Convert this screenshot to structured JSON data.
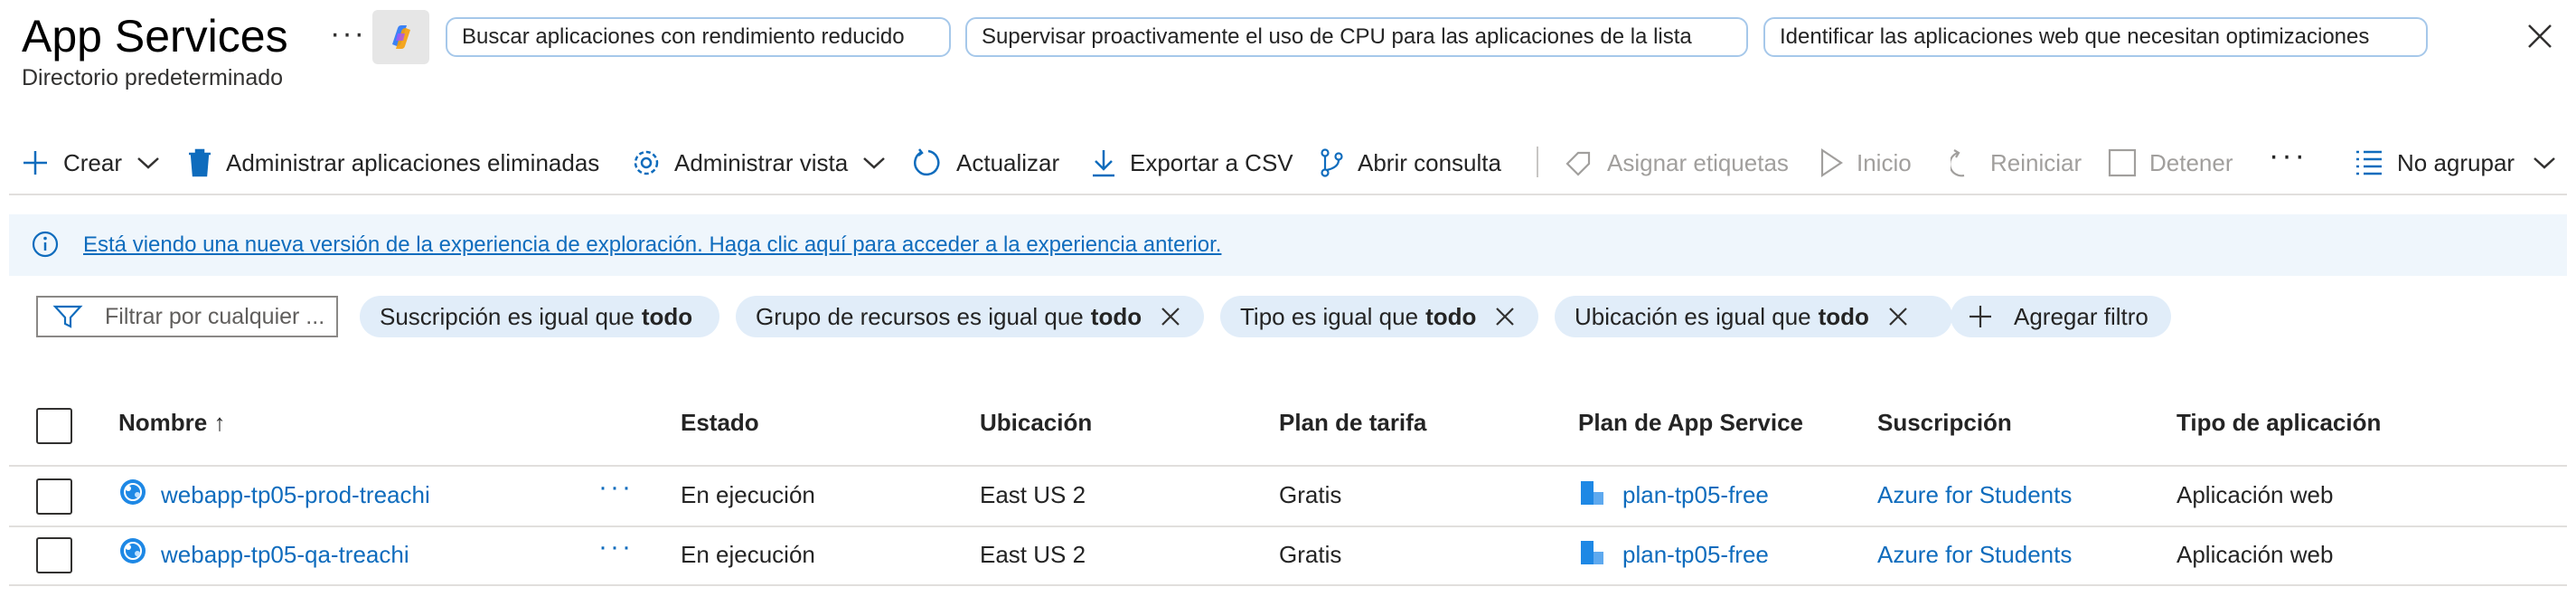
{
  "header": {
    "title": "App Services",
    "subtitle": "Directorio predeterminado",
    "more": "···",
    "suggestions": [
      "Buscar aplicaciones con rendimiento reducido",
      "Supervisar proactivamente el uso de CPU para las aplicaciones de la lista",
      "Identificar las aplicaciones web que necesitan optimizaciones"
    ]
  },
  "toolbar": {
    "create": "Crear",
    "manage_deleted": "Administrar aplicaciones eliminadas",
    "manage_view": "Administrar vista",
    "refresh": "Actualizar",
    "export_csv": "Exportar a CSV",
    "open_query": "Abrir consulta",
    "assign_tags": "Asignar etiquetas",
    "start": "Inicio",
    "restart": "Reiniciar",
    "stop": "Detener",
    "more": "···",
    "grouping": "No agrupar"
  },
  "banner": {
    "text": "Está viendo una nueva versión de la experiencia de exploración. Haga clic aquí para acceder a la experiencia anterior."
  },
  "filters": {
    "search_placeholder": "Filtrar por cualquier ...",
    "chips": [
      {
        "label": "Suscripción es igual que",
        "value": "todo",
        "removable": false
      },
      {
        "label": "Grupo de recursos es igual que",
        "value": "todo",
        "removable": true
      },
      {
        "label": "Tipo es igual que",
        "value": "todo",
        "removable": true
      },
      {
        "label": "Ubicación es igual que",
        "value": "todo",
        "removable": true
      }
    ],
    "add_filter": "Agregar filtro"
  },
  "table": {
    "columns": [
      "Nombre ↑",
      "Estado",
      "Ubicación",
      "Plan de tarifa",
      "Plan de App Service",
      "Suscripción",
      "Tipo de aplicación"
    ],
    "rows": [
      {
        "name": "webapp-tp05-prod-treachi",
        "status": "En ejecución",
        "location": "East US 2",
        "tier": "Gratis",
        "plan": "plan-tp05-free",
        "subscription": "Azure for Students",
        "type": "Aplicación web"
      },
      {
        "name": "webapp-tp05-qa-treachi",
        "status": "En ejecución",
        "location": "East US 2",
        "tier": "Gratis",
        "plan": "plan-tp05-free",
        "subscription": "Azure for Students",
        "type": "Aplicación web"
      }
    ],
    "row_more": "···"
  },
  "colors": {
    "accent": "#0f6cbd",
    "banner_bg": "#eff6fc",
    "chip_bg": "#e1edf9"
  }
}
